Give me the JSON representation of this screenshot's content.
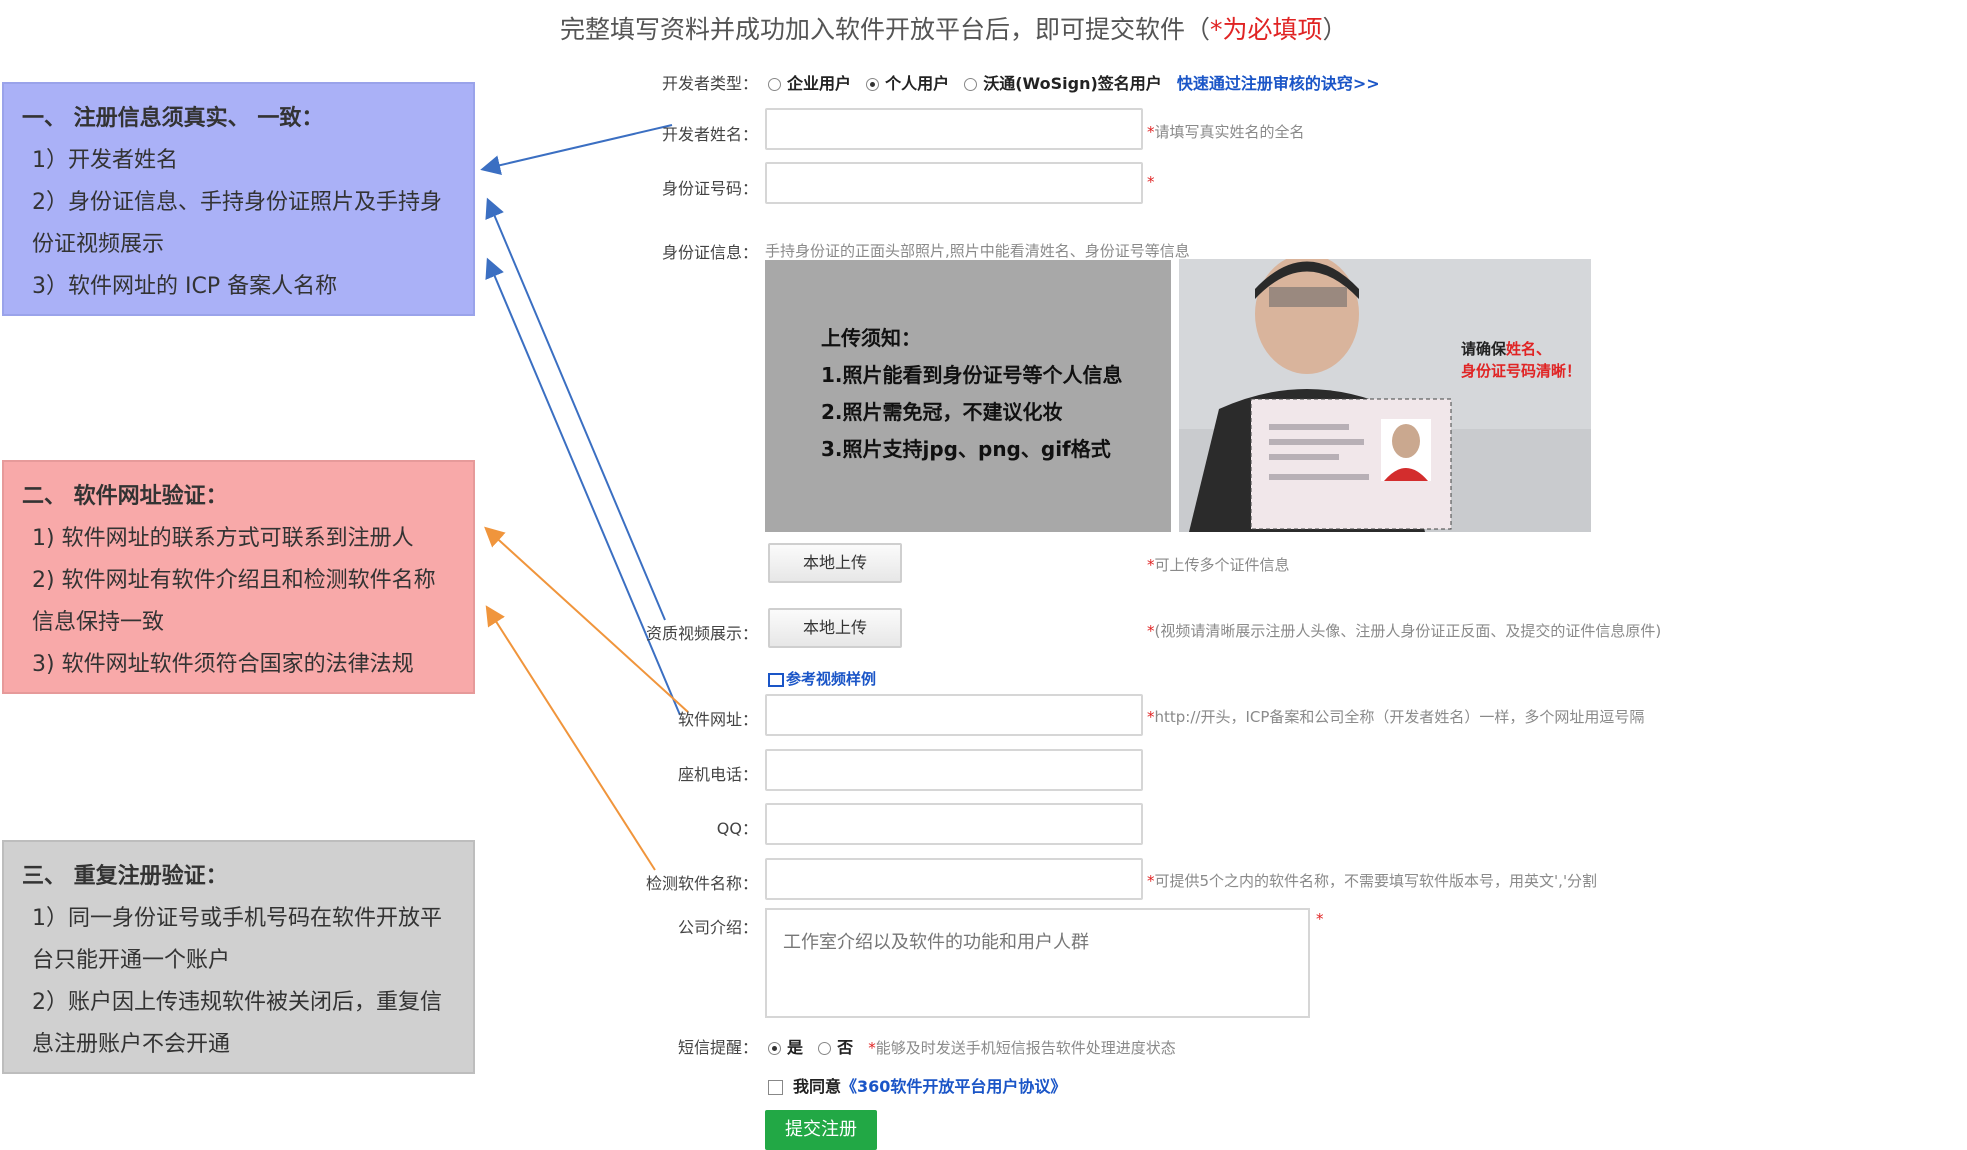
{
  "header": {
    "text": "完整填写资料并成功加入软件开放平台后，即可提交软件（",
    "required_text": "*为必填项",
    "close": "）"
  },
  "notes": [
    {
      "title": "一、  注册信息须真实、 一致：",
      "items": [
        "1）开发者姓名",
        "2）身份证信息、手持身份证照片及手持身份证视频展示",
        "3）软件网址的 ICP 备案人名称"
      ],
      "color": "#aab1f7"
    },
    {
      "title": "二、  软件网址验证：",
      "items": [
        "1) 软件网址的联系方式可联系到注册人",
        "2) 软件网址有软件介绍且和检测软件名称信息保持一致",
        "3) 软件网址软件须符合国家的法律法规"
      ],
      "color": "#f8a9a9"
    },
    {
      "title": "三、  重复注册验证：",
      "items": [
        "1）同一身份证号或手机号码在软件开放平台只能开通一个账户",
        "2）账户因上传违规软件被关闭后，重复信息注册账户不会开通"
      ],
      "color": "#d0d0d0"
    }
  ],
  "form": {
    "dev_type_label": "开发者类型：",
    "dev_type_options": [
      "企业用户",
      "个人用户",
      "沃通(WoSign)签名用户"
    ],
    "dev_type_selected": "个人用户",
    "dev_type_link": "快速通过注册审核的诀窍>>",
    "name_label": "开发者姓名：",
    "name_hint": "请填写真实姓名的全名",
    "id_label": "身份证号码：",
    "id_info_label": "身份证信息：",
    "id_info_hint": "手持身份证的正面头部照片,照片中能看清姓名、身份证号等信息",
    "upload_notice_title": "上传须知：",
    "upload_notice_items": [
      "1.照片能看到身份证号等个人信息",
      "2.照片需免冠，不建议化妆",
      "3.照片支持jpg、png、gif格式"
    ],
    "photo_caption_1": "请确保",
    "photo_caption_2": "姓名、",
    "photo_caption_3": "身份证号码清晰！",
    "upload_button": "本地上传",
    "upload_hint": "可上传多个证件信息",
    "video_label": "资质视频展示：",
    "video_button": "本地上传",
    "video_hint": "(视频请清晰展示注册人头像、注册人身份证正反面、及提交的证件信息原件)",
    "video_sample_link": "参考视频样例",
    "website_label": "软件网址：",
    "website_hint": "http://开头，ICP备案和公司全称（开发者姓名）一样，多个网址用逗号隔",
    "phone_label": "座机电话：",
    "qq_label": "QQ：",
    "software_name_label": "检测软件名称：",
    "software_name_hint": "可提供5个之内的软件名称，不需要填写软件版本号，用英文','分割",
    "intro_label": "公司介绍：",
    "intro_placeholder": "工作室介绍以及软件的功能和用户人群",
    "sms_label": "短信提醒：",
    "sms_yes": "是",
    "sms_no": "否",
    "sms_hint": "能够及时发送手机短信报告软件处理进度状态",
    "agree_prefix": "我同意",
    "agree_link": "《360软件开放平台用户协议》",
    "submit": "提交注册",
    "required_mark": "*"
  }
}
